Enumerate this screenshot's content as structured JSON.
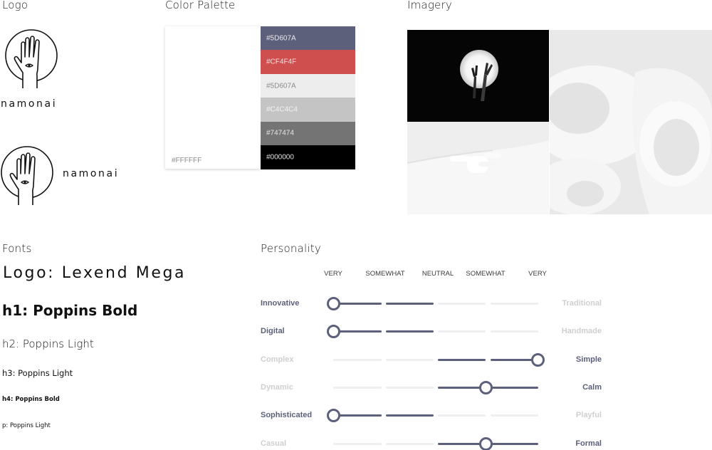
{
  "sections": {
    "logo": "Logo",
    "palette": "Color Palette",
    "imagery": "Imagery",
    "fonts": "Fonts",
    "personality": "Personality"
  },
  "logo": {
    "wordmark": "namonai"
  },
  "palette": {
    "base": {
      "hex": "#FFFFFF",
      "color": "#FFFFFF"
    },
    "swatches": [
      {
        "hex": "#5D607A",
        "color": "#5D607A",
        "text_color": "#E9E9EF"
      },
      {
        "hex": "#CF4F4F",
        "color": "#CF4F4F",
        "text_color": "#F6E0E0"
      },
      {
        "hex": "#5D607A",
        "color": "#EDEDED",
        "text_color": "#8C8C8C"
      },
      {
        "hex": "#C4C4C4",
        "color": "#C4C4C4",
        "text_color": "#F3F3F3"
      },
      {
        "hex": "#747474",
        "color": "#747474",
        "text_color": "#E6E6E6"
      },
      {
        "hex": "#000000",
        "color": "#000000",
        "text_color": "#E0E0E0"
      }
    ]
  },
  "fonts": {
    "logo": "Logo: Lexend Mega",
    "h1": "h1: Poppins Bold",
    "h2": "h2: Poppins Light",
    "h3": "h3: Poppins Light",
    "h4": "h4: Poppins Bold",
    "p": "p: Poppins Light"
  },
  "personality": {
    "scale": [
      "VERY",
      "SOMEWHAT",
      "NEUTRAL",
      "SOMEWHAT",
      "VERY"
    ],
    "active_color": "#5D607A",
    "inactive_color": "#EFEFF2",
    "muted_text_color": "#CFCFCF",
    "rows": [
      {
        "left": "Innovative",
        "right": "Traditional",
        "value": 0
      },
      {
        "left": "Digital",
        "right": "Handmade",
        "value": 0
      },
      {
        "left": "Complex",
        "right": "Simple",
        "value": 4
      },
      {
        "left": "Dynamic",
        "right": "Calm",
        "value": 3
      },
      {
        "left": "Sophisticated",
        "right": "Playful",
        "value": 0
      },
      {
        "left": "Casual",
        "right": "Formal",
        "value": 3
      }
    ]
  }
}
